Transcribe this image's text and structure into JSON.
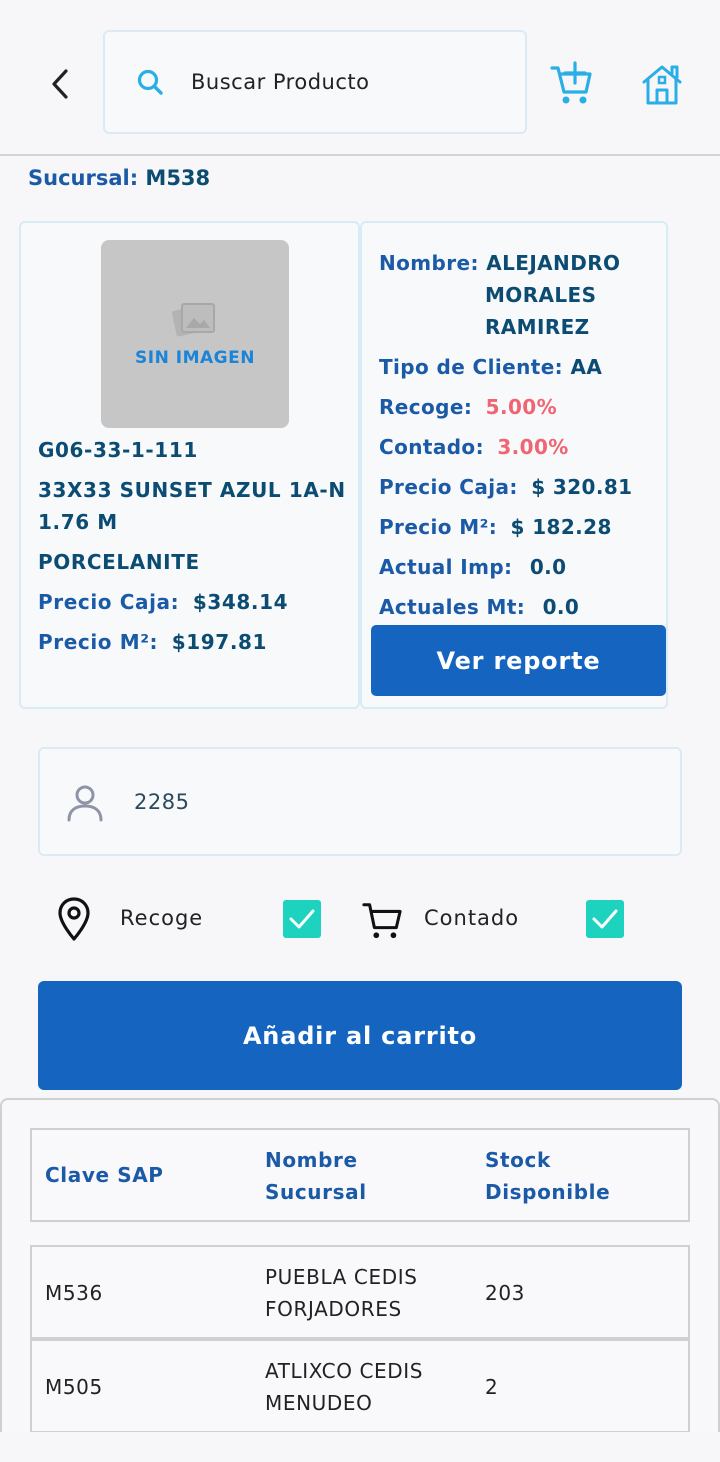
{
  "header": {
    "search_placeholder": "Buscar Producto"
  },
  "sucursal": {
    "label": "Sucursal:",
    "value": "M538"
  },
  "product": {
    "no_image_label": "SIN IMAGEN",
    "code": "G06-33-1-111",
    "name_line1": "33X33 SUNSET AZUL 1A-N",
    "name_line2": "1.76 M",
    "brand": "PORCELANITE",
    "precio_caja_label": "Precio Caja:",
    "precio_caja_value": "$348.14",
    "precio_m2_label": "Precio M²:",
    "precio_m2_value": "$197.81"
  },
  "client": {
    "nombre_label": "Nombre:",
    "nombre_line1": "ALEJANDRO",
    "nombre_line2": "MORALES",
    "nombre_line3": "RAMIREZ",
    "tipo_label": "Tipo de Cliente:",
    "tipo_value": "AA",
    "recoge_label": "Recoge:",
    "recoge_value": "5.00%",
    "contado_label": "Contado:",
    "contado_value": "3.00%",
    "precio_caja_label": "Precio Caja:",
    "precio_caja_value": "$ 320.81",
    "precio_m2_label": "Precio M²:",
    "precio_m2_value": "$ 182.28",
    "actual_imp_label": "Actual Imp:",
    "actual_imp_value": "0.0",
    "actuales_mt_label": "Actuales Mt:",
    "actuales_mt_value": "0.0",
    "report_button": "Ver reporte"
  },
  "client_input": {
    "value": "2285"
  },
  "options": {
    "recoge_label": "Recoge",
    "recoge_checked": true,
    "contado_label": "Contado",
    "contado_checked": true
  },
  "add_to_cart_button": "Añadir al carrito",
  "stock_table": {
    "headers": {
      "clave_sap": "Clave SAP",
      "nombre_line1": "Nombre",
      "nombre_line2": "Sucursal",
      "stock_line1": "Stock",
      "stock_line2": "Disponible"
    },
    "rows": [
      {
        "clave": "M536",
        "nombre_line1": "PUEBLA CEDIS",
        "nombre_line2": "FORJADORES",
        "stock": "203"
      },
      {
        "clave": "M505",
        "nombre_line1": "ATLIXCO CEDIS",
        "nombre_line2": "MENUDEO",
        "stock": "2"
      }
    ]
  },
  "colors": {
    "primary": "#1565c0",
    "label_blue": "#1b5aa6",
    "value_dark": "#0c4c73",
    "percent_red": "#ef6573",
    "checkbox_teal": "#1ed2c0",
    "icon_cyan": "#2aaee6"
  }
}
